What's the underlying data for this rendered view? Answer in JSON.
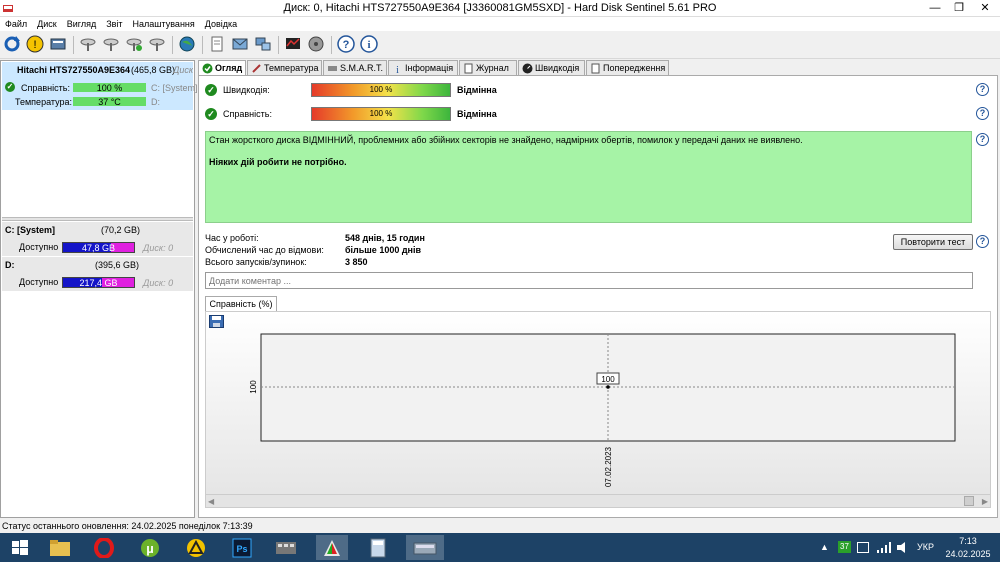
{
  "window": {
    "title": "Диск: 0, Hitachi HTS727550A9E364 [J3360081GM5SXD]  -  Hard Disk Sentinel 5.61 PRO",
    "min": "—",
    "max": "❐",
    "close": "✕"
  },
  "menu": [
    "Файл",
    "Диск",
    "Вигляд",
    "Звіт",
    "Налаштування",
    "Довідка"
  ],
  "disk": {
    "name": "Hitachi HTS727550A9E364",
    "size": "(465,8 GB)",
    "suffix": "Диск",
    "health_label": "Справність:",
    "health_value": "100 %",
    "health_fraction": 1.0,
    "health_vol": "C: [System]",
    "temp_label": "Температура:",
    "temp_value": "37 °C",
    "temp_vol": "D:"
  },
  "volumes": [
    {
      "name": "C: [System]",
      "size": "(70,2 GB)",
      "free_label": "Доступно",
      "free": "47,8 GB",
      "free_fraction": 0.68,
      "disk": "Диск: 0"
    },
    {
      "name": "D:",
      "size": "(395,6 GB)",
      "free_label": "Доступно",
      "free": "217,4 GB",
      "free_fraction": 0.55,
      "disk": "Диск: 0"
    }
  ],
  "tabs": [
    "Огляд",
    "Температура",
    "S.M.A.R.T.",
    "Інформація",
    "Журнал",
    "Швидкодія",
    "Попередження"
  ],
  "overview": {
    "speed_label": "Швидкодія:",
    "speed_value": "100 %",
    "speed_fraction": 1.0,
    "speed_status": "Відмінна",
    "health_label": "Справність:",
    "health_value": "100 %",
    "health_fraction": 1.0,
    "health_status": "Відмінна",
    "message1": "Стан жорсткого диска ВІДМІННИЙ, проблемних або збійних секторів не знайдено, надмірних обертів, помилок у передачі даних не виявлено.",
    "message2": "Ніяких дій робити не потрібно.",
    "uptime_label": "Час у роботі:",
    "uptime_value": "548 днів, 15 годин",
    "lifetime_label": "Обчислений час до відмови:",
    "lifetime_value": "більше 1000 днів",
    "starts_label": "Всього запусків/зупинок:",
    "starts_value": "3 850",
    "retest_button": "Повторити тест",
    "comment_placeholder": "Додати коментар ...",
    "chart_tab": "Справність (%)"
  },
  "chart_data": {
    "type": "line",
    "title": "Справність (%)",
    "x": [
      "07.02.2023"
    ],
    "series": [
      {
        "values": [
          100
        ]
      }
    ],
    "ytick": "100",
    "point_label": "100"
  },
  "status": "Статус останнього оновлення: 24.02.2025 понеділок 7:13:39",
  "tray": {
    "badge": "37",
    "lang": "УКР",
    "time": "7:13",
    "date": "24.02.2025"
  },
  "colors": {
    "selection": "#cce8ff",
    "health_bar": "#66dd66",
    "volume_free": "#1414c8",
    "volume_used": "#e020e0",
    "message_bg": "#a6f3a6"
  }
}
